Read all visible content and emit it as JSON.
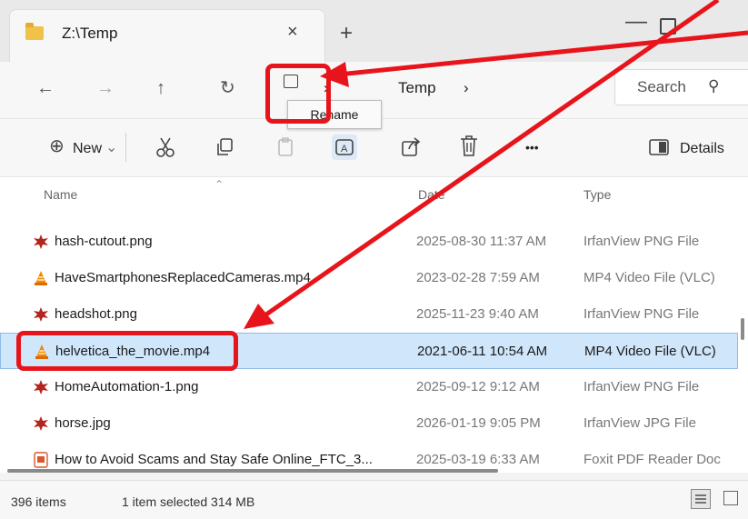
{
  "window": {
    "tab_title": "Z:\\Temp",
    "tab_close": "×",
    "new_tab": "+",
    "minimize": "—"
  },
  "nav": {
    "back": "←",
    "forward": "→",
    "up": "↑",
    "refresh": "↻",
    "crumb_sep": "›",
    "crumb_folder": "Temp",
    "crumb_sep2": "›",
    "search_placeholder": "Search",
    "search_icon": "⚲"
  },
  "tooltip": {
    "text": "Rename"
  },
  "toolbar": {
    "new_label": "New",
    "new_glyph": "⊕",
    "new_chevron": "⌄",
    "more": "•••",
    "details_label": "Details"
  },
  "columns": {
    "name": "Name",
    "date": "Date",
    "type": "Type"
  },
  "files": [
    {
      "name": "hash-cutout.png",
      "date": "2025-08-30 11:37 AM",
      "type": "IrfanView PNG File",
      "icon": "irfanview-icon"
    },
    {
      "name": "HaveSmartphonesReplacedCameras.mp4",
      "date": "2023-02-28 7:59 AM",
      "type": "MP4 Video File (VLC)",
      "icon": "vlc-icon"
    },
    {
      "name": "headshot.png",
      "date": "2025-11-23 9:40 AM",
      "type": "IrfanView PNG File",
      "icon": "irfanview-icon"
    },
    {
      "name": "helvetica_the_movie.mp4",
      "date": "2021-06-11 10:54 AM",
      "type": "MP4 Video File (VLC)",
      "icon": "vlc-icon",
      "selected": true
    },
    {
      "name": "HomeAutomation-1.png",
      "date": "2025-09-12 9:12 AM",
      "type": "IrfanView PNG File",
      "icon": "irfanview-icon"
    },
    {
      "name": "horse.jpg",
      "date": "2026-01-19 9:05 PM",
      "type": "IrfanView JPG File",
      "icon": "irfanview-icon"
    },
    {
      "name": "How to Avoid Scams and Stay Safe Online_FTC_3...",
      "date": "2025-03-19 6:33 AM",
      "type": "Foxit PDF Reader Doc",
      "icon": "pdf-icon"
    }
  ],
  "status": {
    "item_count": "396 items",
    "selection": "1 item selected  314 MB"
  },
  "colors": {
    "highlight": "#e8141b",
    "selection": "#cfe6fb",
    "folder": "#f0c24a"
  }
}
